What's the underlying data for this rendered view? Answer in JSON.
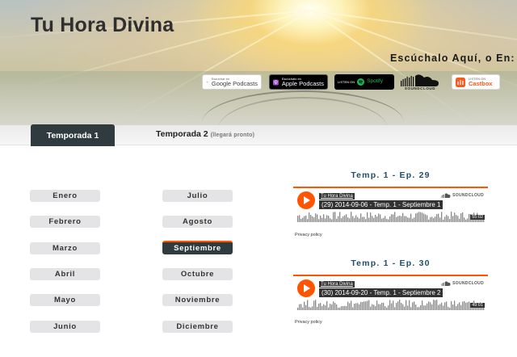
{
  "site": {
    "title": "Tu Hora Divina"
  },
  "listen": {
    "heading": "Escúchalo Aquí, o En:",
    "badges": [
      {
        "id": "google",
        "small": "Escuchar en",
        "big": "Google Podcasts",
        "icon": "google-podcasts-icon"
      },
      {
        "id": "apple",
        "small": "Escúchalo en",
        "big": "Apple Podcasts",
        "icon": "apple-podcasts-icon"
      },
      {
        "id": "spotify",
        "small": "LISTEN ON",
        "big": "Spotify",
        "icon": "spotify-icon"
      },
      {
        "id": "soundcloud",
        "big": "SOUNDCLOUD",
        "icon": "soundcloud-icon"
      },
      {
        "id": "castbox",
        "small": "LISTEN ON",
        "big": "Castbox",
        "icon": "castbox-icon"
      }
    ]
  },
  "tabs": [
    {
      "label": "Temporada 1",
      "active": true
    },
    {
      "label": "Temporada 2",
      "note": "(llegará pronto)",
      "active": false
    }
  ],
  "months": {
    "left": [
      "Enero",
      "Febrero",
      "Marzo",
      "Abril",
      "Mayo",
      "Junio"
    ],
    "right": [
      "Julio",
      "Agosto",
      "Septiembre",
      "Octubre",
      "Noviembre",
      "Diciembre"
    ],
    "active": "Septiembre"
  },
  "episodes": [
    {
      "heading": "Temp. 1 - Ep. 29",
      "user": "Tu Hora Divina",
      "title": "(29) 2014-09-06 - Temp. 1 - Septiembre 1",
      "duration": "55:02",
      "privacy": "Privacy policy",
      "progress": 0
    },
    {
      "heading": "Temp. 1 - Ep. 30",
      "user": "Tu Hora Divina",
      "title": "(30) 2014-09-20 - Temp. 1 - Septiembre 2",
      "duration": "49:01",
      "privacy": "Privacy policy",
      "progress": 0
    }
  ],
  "player_brand": "SOUNDCLOUD",
  "colors": {
    "accent": "#ff5500",
    "tab_active_bg": "#303b3f",
    "heading_blue": "#1f4e66",
    "month_bg": "#e4e4e6",
    "spotify_green": "#1db954",
    "castbox_orange": "#f55b23"
  }
}
